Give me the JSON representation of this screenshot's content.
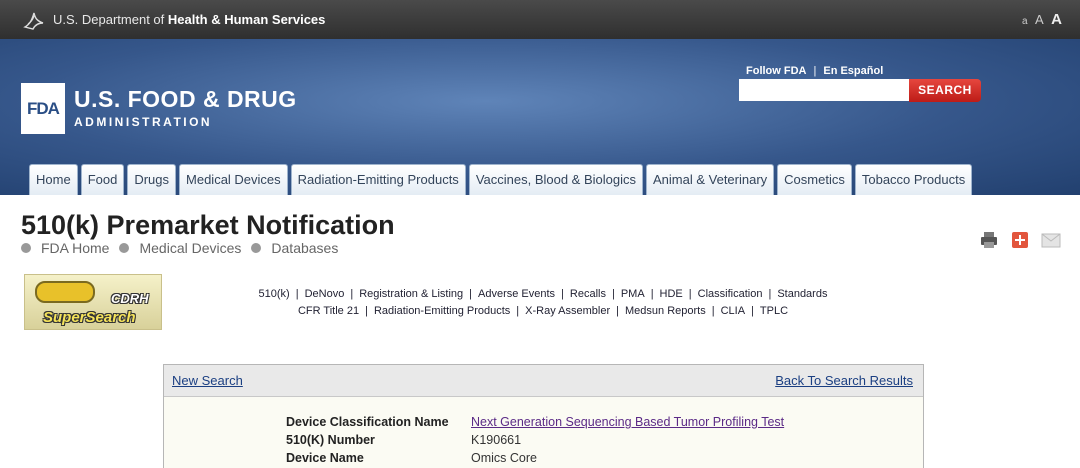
{
  "hhs": {
    "text_prefix": "U.S. Department of ",
    "text_bold": "Health & Human Services",
    "text_size_labels": [
      "a",
      "A",
      "A"
    ]
  },
  "header": {
    "logo_text": "FDA",
    "name_line1": "U.S. FOOD & DRUG",
    "name_line2": "ADMINISTRATION",
    "follow_label": "Follow FDA",
    "espanol_label": "En Español",
    "search_placeholder": "",
    "search_button": "SEARCH"
  },
  "nav": {
    "tabs": [
      "Home",
      "Food",
      "Drugs",
      "Medical Devices",
      "Radiation-Emitting Products",
      "Vaccines, Blood & Biologics",
      "Animal & Veterinary",
      "Cosmetics",
      "Tobacco Products"
    ]
  },
  "page": {
    "title": "510(k) Premarket Notification",
    "breadcrumb": [
      "FDA Home",
      "Medical Devices",
      "Databases"
    ]
  },
  "cdrh": {
    "line1": "CDRH",
    "line2": "SuperSearch"
  },
  "db_links": {
    "row1": [
      "510(k)",
      "DeNovo",
      "Registration & Listing",
      "Adverse Events",
      "Recalls",
      "PMA",
      "HDE",
      "Classification",
      "Standards"
    ],
    "row2": [
      "CFR Title 21",
      "Radiation-Emitting Products",
      "X-Ray Assembler",
      "Medsun Reports",
      "CLIA",
      "TPLC"
    ]
  },
  "results": {
    "new_search": "New Search",
    "back_to_results": "Back To Search Results",
    "rows": [
      {
        "label": "Device Classification Name",
        "value": "Next Generation Sequencing Based Tumor Profiling Test"
      },
      {
        "label": "510(K) Number",
        "value": "K190661"
      },
      {
        "label": "Device Name",
        "value": "Omics Core"
      }
    ]
  },
  "colors": {
    "accent_red": "#c4211c",
    "header_blue": "#36578b",
    "link_purple": "#5b2a86"
  }
}
